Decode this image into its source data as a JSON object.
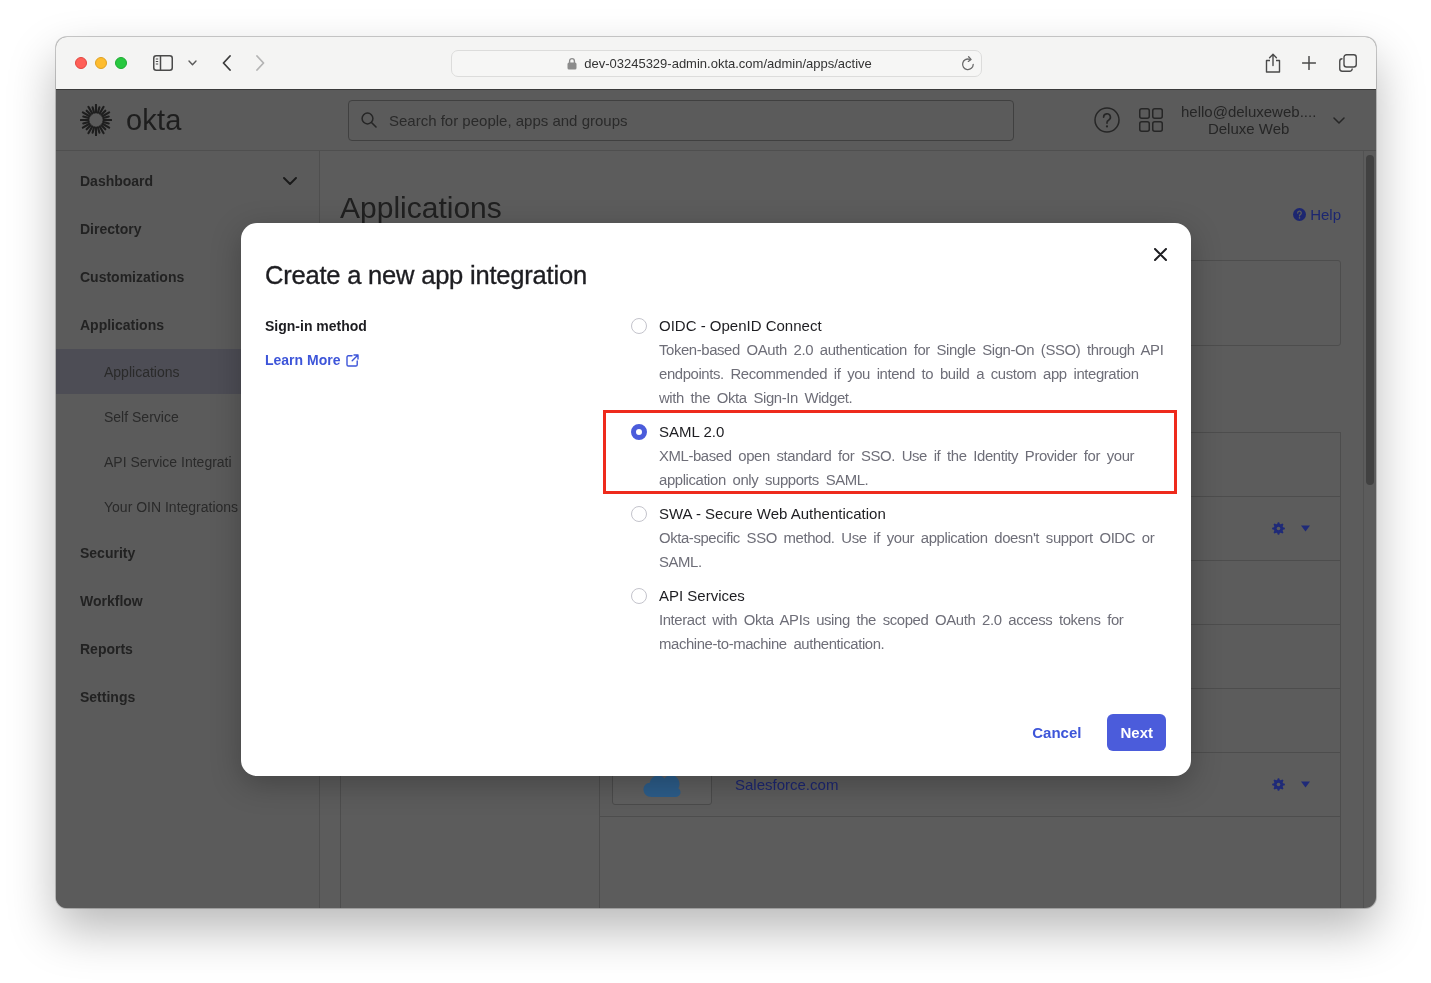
{
  "browser": {
    "url": "dev-03245329-admin.okta.com/admin/apps/active",
    "back_disabled": false,
    "forward_disabled": true
  },
  "header": {
    "logo_text": "okta",
    "search": {
      "placeholder": "Search for people, apps and groups"
    },
    "account": {
      "email": "hello@deluxeweb....",
      "org": "Deluxe Web"
    }
  },
  "sidebar": {
    "items": [
      {
        "label": "Dashboard",
        "chevron": true
      },
      {
        "label": "Directory",
        "chevron": false
      },
      {
        "label": "Customizations",
        "chevron": false
      },
      {
        "label": "Applications",
        "chevron": false,
        "children": [
          {
            "label": "Applications",
            "selected": true
          },
          {
            "label": "Self Service",
            "selected": false
          },
          {
            "label": "API Service Integrati",
            "selected": false
          },
          {
            "label": "Your OIN Integrations",
            "selected": false
          }
        ]
      },
      {
        "label": "Security",
        "chevron": false
      },
      {
        "label": "Workflow",
        "chevron": false
      },
      {
        "label": "Reports",
        "chevron": false
      },
      {
        "label": "Settings",
        "chevron": false
      }
    ]
  },
  "page": {
    "heading": "Applications",
    "help_link": "Help",
    "rows": [
      {
        "kind": "actions"
      },
      {
        "kind": "blank"
      },
      {
        "kind": "blank"
      },
      {
        "kind": "blank"
      },
      {
        "kind": "app",
        "name": "Salesforce.com"
      }
    ]
  },
  "dialog": {
    "title": "Create a new app integration",
    "section_label": "Sign-in method",
    "learn_more": "Learn More",
    "options": [
      {
        "title": "OIDC - OpenID Connect",
        "description": "Token-based OAuth 2.0 authentication for Single Sign-On (SSO) through API endpoints. Recommended if you intend to build a custom app integration with the Okta Sign-In Widget.",
        "selected": false,
        "highlighted": false
      },
      {
        "title": "SAML 2.0",
        "description": "XML-based open standard for SSO. Use if the Identity Provider for your application only supports SAML.",
        "selected": true,
        "highlighted": true
      },
      {
        "title": "SWA - Secure Web Authentication",
        "description": "Okta-specific SSO method. Use if your application doesn't support OIDC or SAML.",
        "selected": false,
        "highlighted": false
      },
      {
        "title": "API Services",
        "description": "Interact with Okta APIs using the scoped OAuth 2.0 access tokens for machine-to-machine authentication.",
        "selected": false,
        "highlighted": false
      }
    ],
    "buttons": [
      {
        "label": "Cancel",
        "kind": "link"
      },
      {
        "label": "Next",
        "kind": "primary"
      }
    ]
  }
}
